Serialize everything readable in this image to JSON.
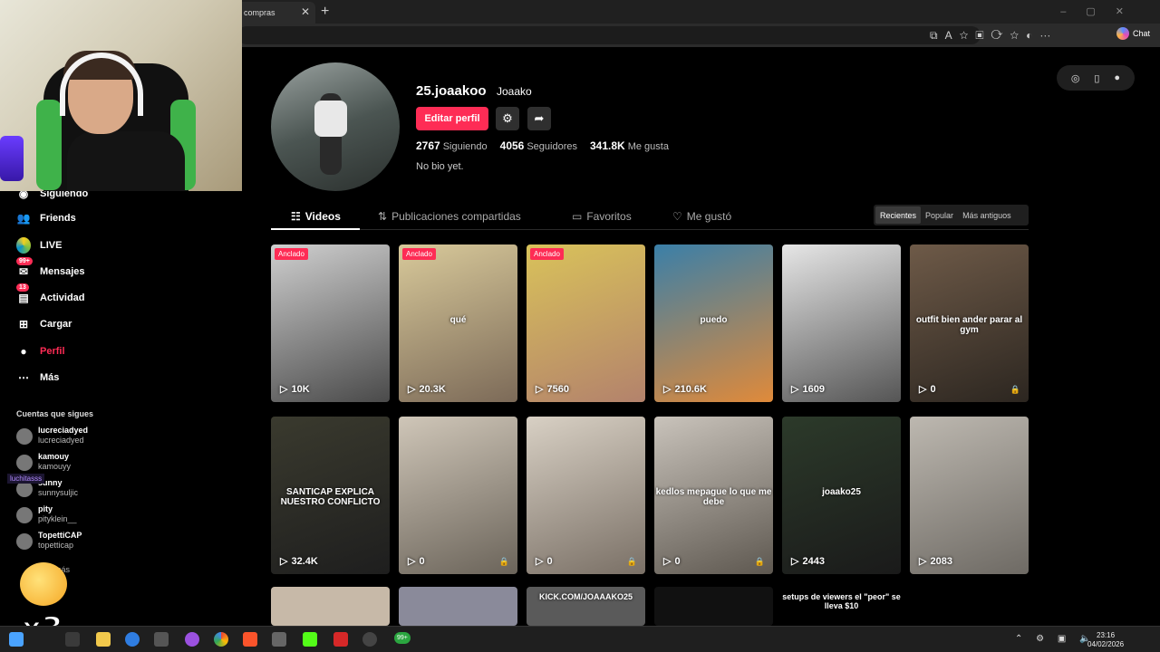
{
  "browser": {
    "tab_title": "compras",
    "tab_close": "✕",
    "new_tab": "+",
    "chat_label": "Chat"
  },
  "sidebar": {
    "partial_item": "Siguiendo",
    "items": [
      {
        "label": "Friends",
        "icon": "friends-icon",
        "active": false
      },
      {
        "label": "LIVE",
        "icon": "live-icon",
        "active": false
      },
      {
        "label": "Mensajes",
        "icon": "message-icon",
        "badge": "99+",
        "active": false
      },
      {
        "label": "Actividad",
        "icon": "activity-icon",
        "badge": "13",
        "active": false
      },
      {
        "label": "Cargar",
        "icon": "upload-icon",
        "active": false
      },
      {
        "label": "Perfil",
        "icon": "profile-icon",
        "active": true
      },
      {
        "label": "Más",
        "icon": "more-icon",
        "active": false
      }
    ],
    "following_title": "Cuentas que sigues",
    "following": [
      {
        "name": "lucreciadyed",
        "username": "lucreciadyed"
      },
      {
        "name": "kamouy",
        "username": "kamouyy"
      },
      {
        "name": "sunny",
        "username": "sunnysuljic"
      },
      {
        "name": "pity",
        "username": "pityklein__"
      },
      {
        "name": "TopettiCAP",
        "username": "topetticap"
      }
    ],
    "overlay_tag": "luchitasss",
    "overlay_more": "más",
    "overlay_multiplier": "x3"
  },
  "profile": {
    "username": "25.joaakoo",
    "nickname": "Joaako",
    "edit_label": "Editar perfil",
    "following_count": "2767",
    "following_label": "Siguiendo",
    "followers_count": "4056",
    "followers_label": "Seguidores",
    "likes_count": "341.8K",
    "likes_label": "Me gusta",
    "bio": "No bio yet."
  },
  "tabs": [
    {
      "label": "Videos",
      "active": true
    },
    {
      "label": "Publicaciones compartidas",
      "active": false
    },
    {
      "label": "Favoritos",
      "active": false
    },
    {
      "label": "Me gustó",
      "active": false
    }
  ],
  "sort": [
    "Recientes",
    "Popular",
    "Más antiguos"
  ],
  "videos": [
    {
      "views": "10K",
      "pinned": "Anclado",
      "caption": "",
      "color_a": "#cfcfcf",
      "color_b": "#4a4a4a",
      "locked": false
    },
    {
      "views": "20.3K",
      "pinned": "Anclado",
      "caption": "qué",
      "color_a": "#d8c99a",
      "color_b": "#7c6a58",
      "locked": false
    },
    {
      "views": "7560",
      "pinned": "Anclado",
      "caption": "",
      "color_a": "#d9c25a",
      "color_b": "#b3826c",
      "locked": false
    },
    {
      "views": "210.6K",
      "pinned": "",
      "caption": "puedo",
      "color_a": "#3a7fa8",
      "color_b": "#e08a3a",
      "locked": false
    },
    {
      "views": "1609",
      "pinned": "",
      "caption": "",
      "color_a": "#e6e6e6",
      "color_b": "#555555",
      "locked": false
    },
    {
      "views": "0",
      "pinned": "",
      "caption": "outfit bien ander parar al gym",
      "color_a": "#6e5a48",
      "color_b": "#2c2620",
      "locked": true
    },
    {
      "views": "32.4K",
      "pinned": "",
      "caption": "SANTICAP EXPLICA NUESTRO CONFLICTO",
      "color_a": "#3a3a2e",
      "color_b": "#1e1e1e",
      "locked": false
    },
    {
      "views": "0",
      "pinned": "",
      "caption": "",
      "color_a": "#cfc6b8",
      "color_b": "#6b645a",
      "locked": true
    },
    {
      "views": "0",
      "pinned": "",
      "caption": "",
      "color_a": "#d8d0c4",
      "color_b": "#7a7066",
      "locked": true
    },
    {
      "views": "0",
      "pinned": "",
      "caption": "kedlos mepague lo que me debe",
      "color_a": "#c9c3bb",
      "color_b": "#5e5850",
      "locked": true
    },
    {
      "views": "2443",
      "pinned": "",
      "caption": "joaako25",
      "color_a": "#2c3a2a",
      "color_b": "#1a1a1a",
      "locked": false
    },
    {
      "views": "2083",
      "pinned": "",
      "caption": "",
      "color_a": "#bdb8b0",
      "color_b": "#6e6a64",
      "locked": false
    }
  ],
  "partial_row": [
    {
      "caption": "",
      "color_a": "#c7b9a8"
    },
    {
      "caption": "",
      "color_a": "#8a8a9a"
    },
    {
      "caption": "KICK.COM/JOAAAKO25",
      "color_a": "#5a5a5a"
    },
    {
      "caption": "",
      "color_a": "#111111"
    },
    {
      "caption": "setups de viewers el \"peor\" se lleva $10",
      "color_a": "#000000"
    }
  ],
  "taskbar": {
    "badge": "99+",
    "time": "23:16",
    "date": "04/02/2026"
  },
  "colors": {
    "accent": "#fe2c55",
    "background": "#000000"
  }
}
